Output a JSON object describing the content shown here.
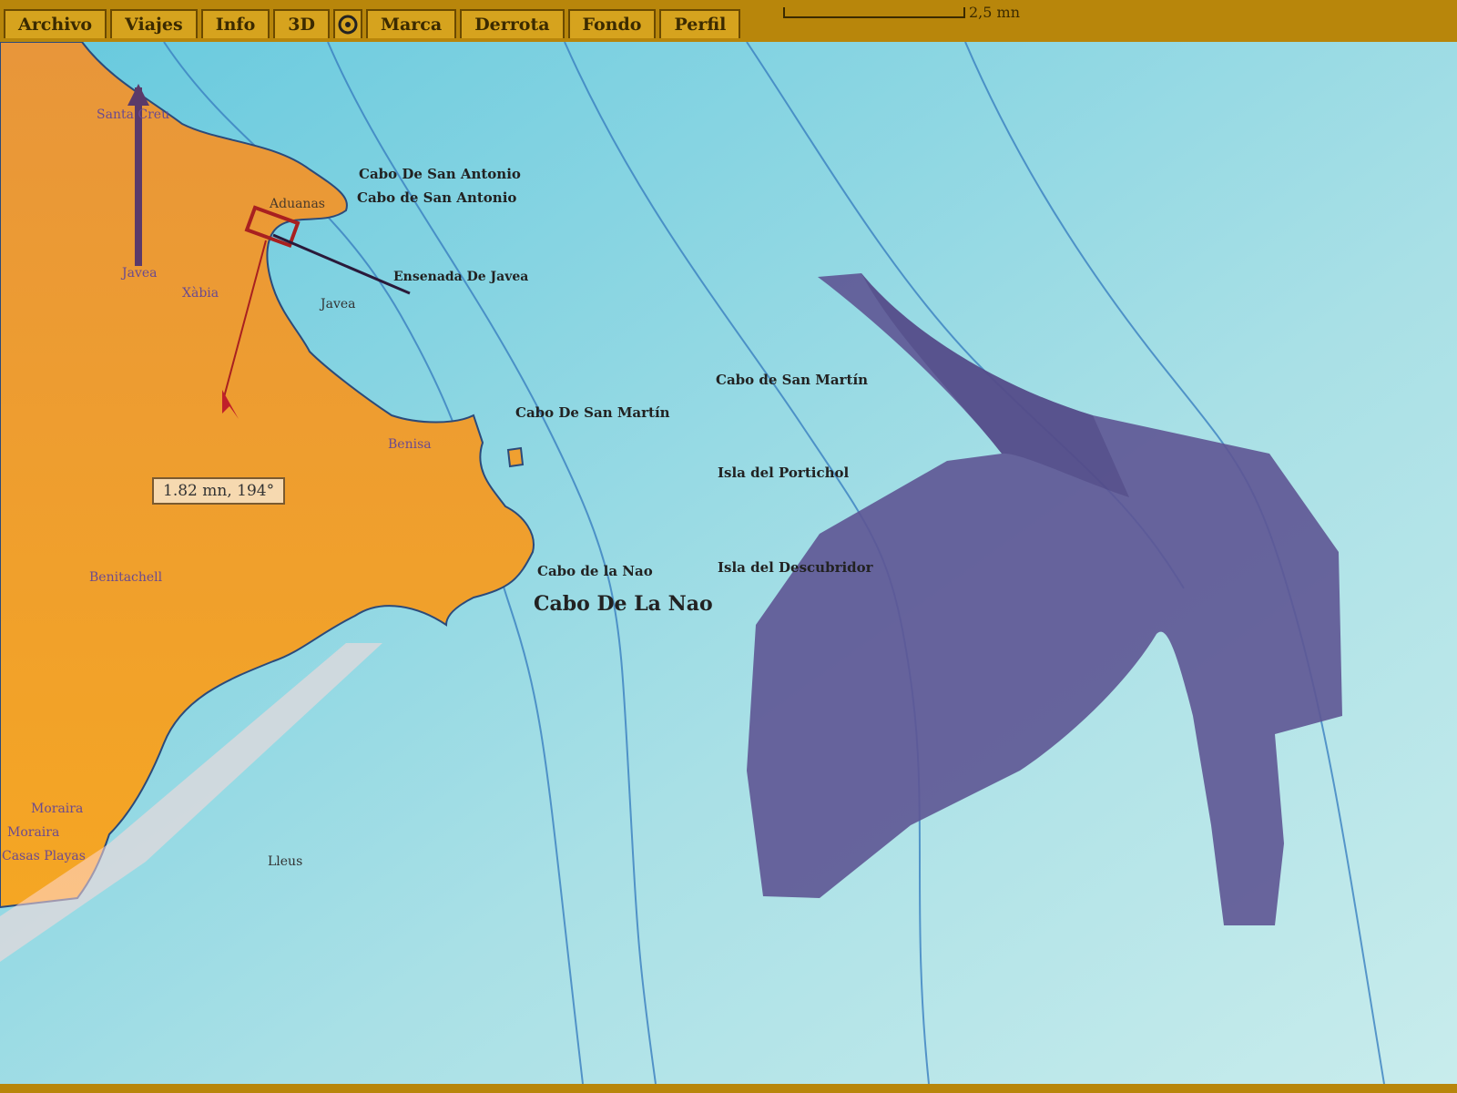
{
  "menu": {
    "items": [
      "Archivo",
      "Viajes",
      "Info",
      "3D"
    ],
    "items_after_icon": [
      "Marca",
      "Derrota",
      "Fondo",
      "Perfil"
    ],
    "icon": "target-icon"
  },
  "scale": {
    "label": "2,5 mn"
  },
  "measure": {
    "label": "1.82 mn, 194°"
  },
  "places": {
    "cabo_san_antonio_1": "Cabo De San Antonio",
    "cabo_san_antonio_2": "Cabo de San Antonio",
    "ensenada_javea": "Ensenada De Javea",
    "cabo_san_martin_sea": "Cabo de San Martín",
    "cabo_san_martin_coast": "Cabo De San Martín",
    "isla_portichol": "Isla del Portichol",
    "isla_descubridor": "Isla del Descubridor",
    "cabo_nao_small": "Cabo de la Nao",
    "cabo_nao_big": "Cabo De La Nao"
  },
  "towns": {
    "santa": "Santa Creu",
    "aduanas": "Aduanas",
    "javea_n": "Javea",
    "xabia": "Xàbia",
    "javea_s": "Javea",
    "benissa": "Benisa",
    "benitachell": "Benitachell",
    "moraira1": "Moraira",
    "moraira2": "Moraira",
    "cases": "Casas Playas",
    "lleus": "Lleus"
  },
  "colors": {
    "land": "#f0a030",
    "sea": "#7fd3e0",
    "zone": "#5e5594",
    "contour": "#3a7fc0",
    "menu": "#b8860b"
  }
}
